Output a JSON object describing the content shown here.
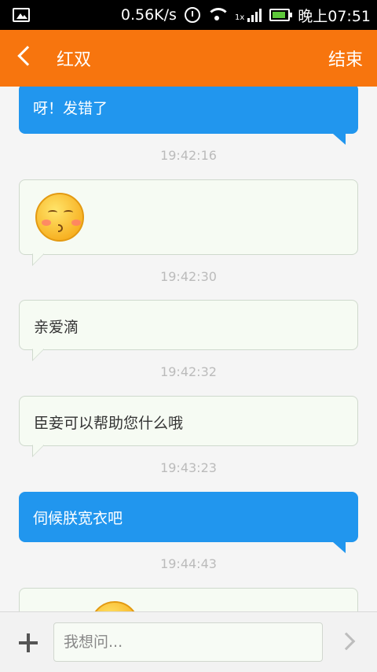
{
  "status_bar": {
    "speed": "0.56K/s",
    "signal_label": "1x",
    "time": "晚上07:51"
  },
  "header": {
    "title": "红双",
    "end_label": "结束"
  },
  "messages": [
    {
      "type": "text",
      "direction": "out",
      "text": "呀！发错了",
      "time": "19:42:16"
    },
    {
      "type": "emoji",
      "direction": "in",
      "emoji": "kissing-face",
      "time": "19:42:30"
    },
    {
      "type": "text",
      "direction": "in",
      "text": "亲爱滴",
      "time": "19:42:32"
    },
    {
      "type": "text",
      "direction": "in",
      "text": "臣妾可以帮助您什么哦",
      "time": "19:43:23"
    },
    {
      "type": "text",
      "direction": "out",
      "text": "伺候朕宽衣吧",
      "time": "19:44:43"
    },
    {
      "type": "emoji",
      "direction": "in",
      "emoji": "kissing-face"
    }
  ],
  "input": {
    "placeholder": "我想问..."
  },
  "colors": {
    "header": "#f7750e",
    "outgoing_bubble": "#2196ee",
    "incoming_bubble": "#f6fbf3"
  }
}
